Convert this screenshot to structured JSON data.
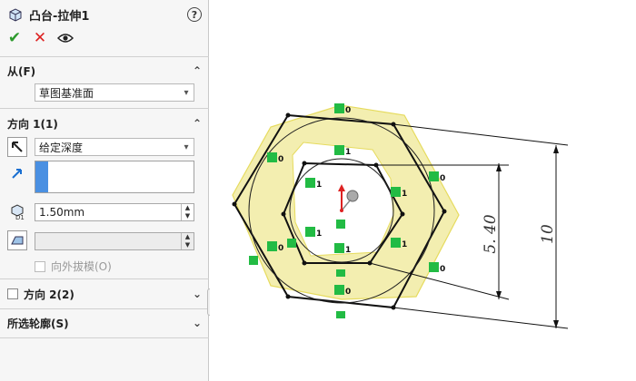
{
  "header": {
    "title": "凸台-拉伸1",
    "help": "?"
  },
  "actions": {
    "ok_icon": "check-icon",
    "cancel_icon": "close-icon",
    "preview_icon": "eye-icon"
  },
  "from_section": {
    "label": "从(F)",
    "value": "草图基准面"
  },
  "direction1": {
    "label": "方向 1(1)",
    "end_condition": "给定深度",
    "depth": "1.50mm",
    "draft_label": "向外拔模(O)"
  },
  "direction2": {
    "label": "方向 2(2)"
  },
  "selected_contours": {
    "label": "所选轮廓(S)"
  },
  "viewport": {
    "dimensions": [
      "5. 40",
      "10"
    ],
    "relation_labels": [
      "0",
      "1",
      "0",
      "1",
      "0",
      "1",
      "1",
      "1",
      "1",
      "0",
      "0"
    ]
  },
  "colors": {
    "accent": "#4a90e2",
    "ok": "#2c9a2c",
    "cancel": "#dd2222",
    "relation": "#22bb44",
    "extrude_fill": "#f3eeb0"
  }
}
